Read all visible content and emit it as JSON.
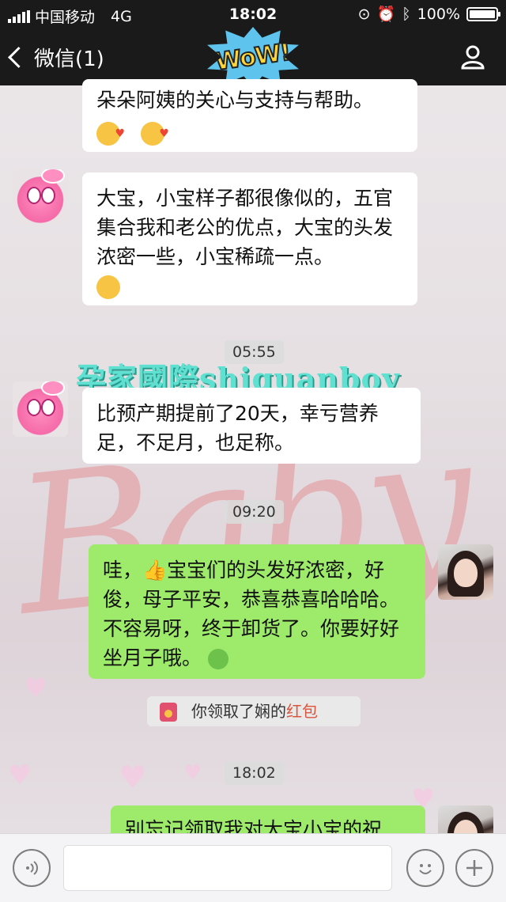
{
  "status_bar": {
    "carrier": "中国移动",
    "network": "4G",
    "time": "18:02",
    "battery": "100%",
    "battery_level": 1.0
  },
  "nav": {
    "back_label": "微信(1)",
    "sticker_text": "WoW!"
  },
  "background": {
    "embroidery_text": "Baby"
  },
  "messages": [
    {
      "text": "朵朵阿姨的关心与支持与帮助。"
    },
    {
      "text": "大宝，小宝样子都很像似的，五官集合我和老公的优点，大宝的头发浓密一些，小宝稀疏一点。"
    },
    {
      "text": "比预产期提前了20天，幸亏营养足，不足月，也足称。"
    },
    {
      "text_part1": "哇，",
      "text_part2": "宝宝们的头发好浓密，好俊，母子平安，恭喜恭喜哈哈哈。不容易呀，终于卸货了。你要好好坐月子哦。"
    },
    {
      "text": "别忘记领取我对大宝小宝的祝"
    }
  ],
  "timestamps": [
    "05:55",
    "09:20",
    "18:02"
  ],
  "watermark": "孕家國際shiguanboy",
  "system_message": {
    "prefix": "你领取了娴的",
    "link": "红包"
  }
}
